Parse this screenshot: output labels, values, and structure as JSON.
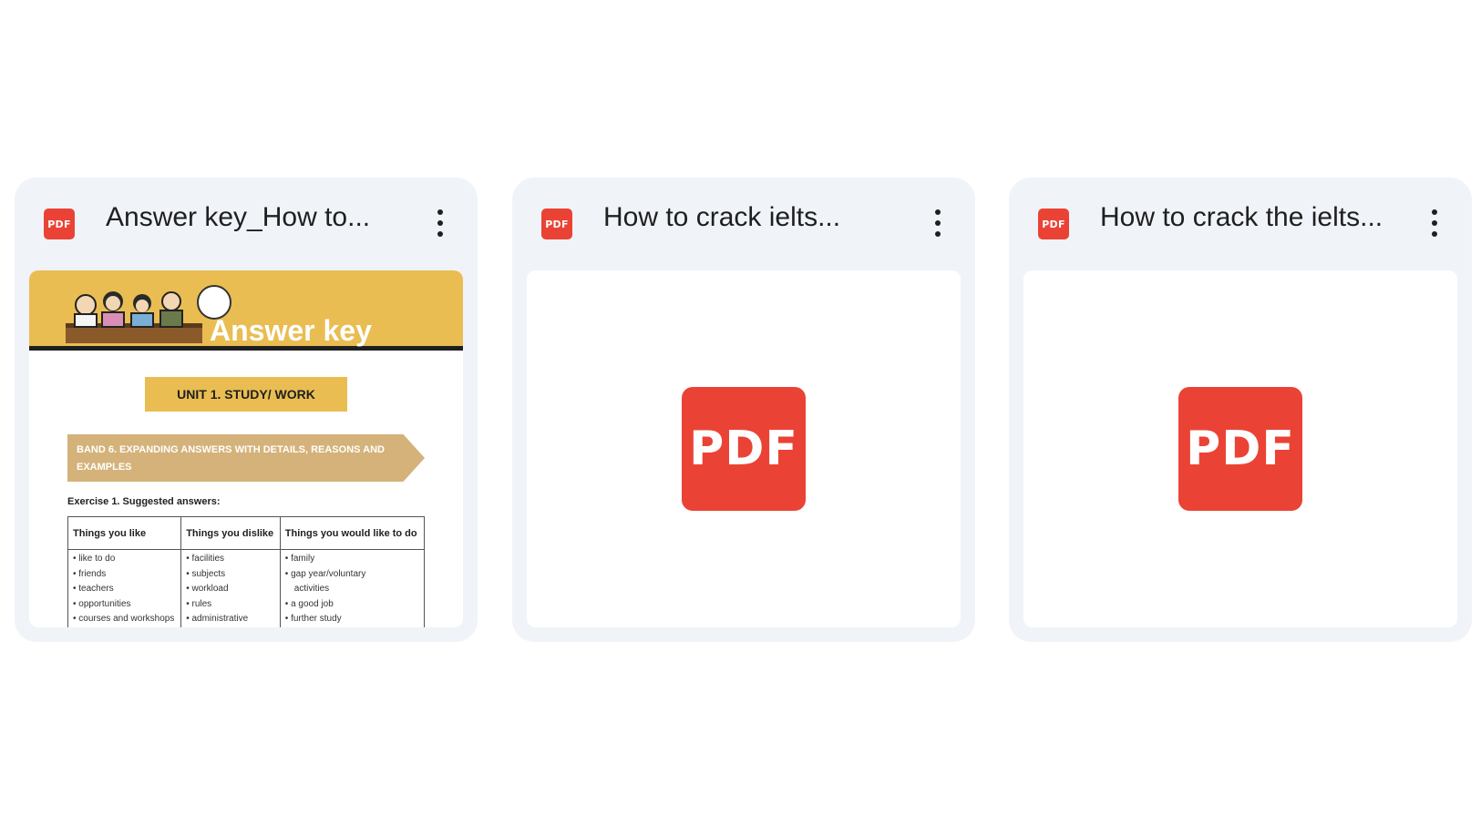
{
  "cards": [
    {
      "title": "Answer key_How to...",
      "badge": "PDF",
      "preview": {
        "banner_title": "Answer key",
        "unit": "UNIT 1. STUDY/ WORK",
        "band": "BAND 6. EXPANDING ANSWERS WITH DETAILS, REASONS AND EXAMPLES",
        "exercise": "Exercise 1. Suggested answers:",
        "table_headers": [
          "Things you like",
          "Things you dislike",
          "Things you would like to do"
        ],
        "table_col_1": [
          "• like to do",
          "• friends",
          "• teachers",
          "• opportunities",
          "• courses and workshops"
        ],
        "table_col_2": [
          "• facilities",
          "• subjects",
          "• workload",
          "• rules",
          "• administrative"
        ],
        "table_col_3": [
          "• family",
          "• gap year/voluntary",
          "activities",
          "• a good job",
          "• further study"
        ]
      }
    },
    {
      "title": "How to crack ielts...",
      "badge": "PDF",
      "preview_icon": "PDF"
    },
    {
      "title": "How to crack the ielts...",
      "badge": "PDF",
      "preview_icon": "PDF"
    }
  ],
  "colors": {
    "card_bg": "#f0f4f9",
    "pdf_red": "#ea4335",
    "banner_yellow": "#e9bd52"
  },
  "icons": {
    "file_type": "pdf-icon",
    "menu": "more-vert-icon"
  }
}
